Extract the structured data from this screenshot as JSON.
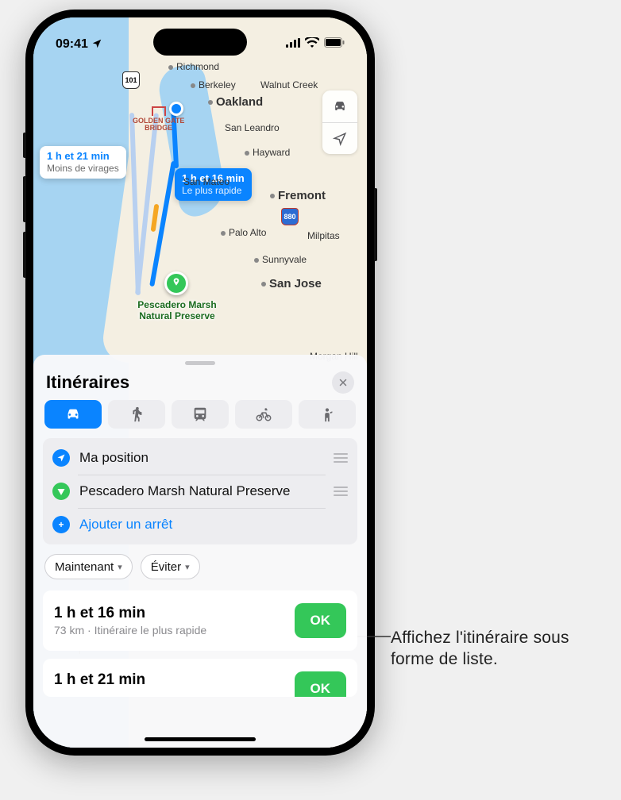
{
  "status_bar": {
    "time": "09:41"
  },
  "map": {
    "cities": {
      "richmond": "Richmond",
      "berkeley": "Berkeley",
      "walnut_creek": "Walnut Creek",
      "oakland": "Oakland",
      "san_leandro": "San Leandro",
      "hayward": "Hayward",
      "san_mateo": "San Mateo",
      "fremont": "Fremont",
      "palo_alto": "Palo Alto",
      "milpitas": "Milpitas",
      "sunnyvale": "Sunnyvale",
      "san_jose": "San Jose",
      "morgan_hill": "Morgan Hill"
    },
    "golden_gate_label": "GOLDEN GATE\nBRIDGE",
    "shield_101": "101",
    "shield_880": "880",
    "callout_primary": {
      "time": "1 h et 16 min",
      "note": "Le plus rapide"
    },
    "callout_secondary": {
      "time": "1 h et 21 min",
      "note": "Moins de virages"
    },
    "destination_label": "Pescadero Marsh\nNatural Preserve"
  },
  "sheet": {
    "title": "Itinéraires",
    "modes": [
      "drive",
      "walk",
      "transit",
      "cycle",
      "rideshare"
    ],
    "selected_mode": "drive",
    "stops": {
      "start": "Ma position",
      "end": "Pescadero Marsh Natural Preserve",
      "add": "Ajouter un arrêt"
    },
    "filters": {
      "when": "Maintenant",
      "avoid": "Éviter"
    },
    "routes": [
      {
        "time": "1 h et 16 min",
        "meta": "73 km · Itinéraire le plus rapide",
        "go": "OK"
      },
      {
        "time": "1 h et 21 min",
        "meta": "",
        "go": "OK"
      }
    ]
  },
  "annotation": "Affichez l'itinéraire sous forme de liste."
}
